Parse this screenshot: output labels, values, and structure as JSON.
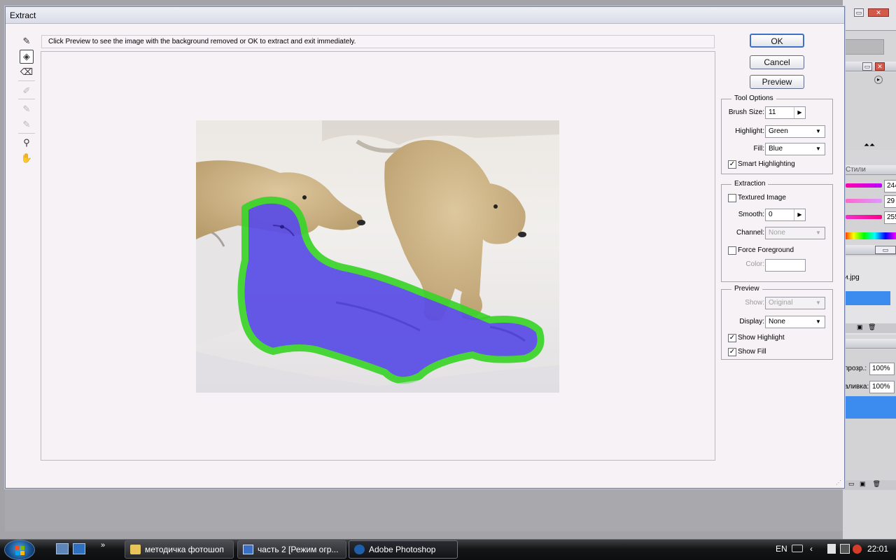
{
  "window": {
    "title": "Extract",
    "hint": "Click Preview to see the image with the background removed or OK to extract and exit immediately."
  },
  "tools": [
    {
      "name": "edge-highlighter-tool",
      "icon": "✎"
    },
    {
      "name": "fill-tool",
      "icon": "◈"
    },
    {
      "name": "eraser-tool",
      "icon": "⌫"
    },
    {
      "name": "eyedropper-tool",
      "icon": "✐"
    },
    {
      "name": "cleanup-tool",
      "icon": "✎"
    },
    {
      "name": "edge-touchup-tool",
      "icon": "✎"
    },
    {
      "name": "zoom-tool",
      "icon": "⚲"
    },
    {
      "name": "hand-tool",
      "icon": "✋"
    }
  ],
  "buttons": {
    "ok": "OK",
    "cancel": "Cancel",
    "preview": "Preview"
  },
  "tool_options": {
    "title": "Tool Options",
    "brush_size_label": "Brush Size:",
    "brush_size": "11",
    "highlight_label": "Highlight:",
    "highlight": "Green",
    "fill_label": "Fill:",
    "fill": "Blue",
    "smart_highlighting": "Smart Highlighting",
    "smart_highlighting_checked": true
  },
  "extraction": {
    "title": "Extraction",
    "textured_image": "Textured Image",
    "textured_image_checked": false,
    "smooth_label": "Smooth:",
    "smooth": "0",
    "channel_label": "Channel:",
    "channel": "None",
    "force_foreground": "Force Foreground",
    "force_foreground_checked": false,
    "color_label": "Color:"
  },
  "preview": {
    "title": "Preview",
    "show_label": "Show:",
    "show": "Original",
    "display_label": "Display:",
    "display": "None",
    "show_highlight": "Show Highlight",
    "show_highlight_checked": true,
    "show_fill": "Show Fill",
    "show_fill_checked": true
  },
  "right_panels": {
    "styles_tab": "Стили",
    "values": [
      "244",
      "29",
      "255"
    ],
    "file_name": "и.jpg",
    "opacity_label": "прозр.:",
    "opacity": "100%",
    "fill_label": "аливка:",
    "fill": "100%"
  },
  "taskbar": {
    "items": [
      {
        "label": "методичка фотошоп",
        "icon": "folder-icon"
      },
      {
        "label": "часть 2 [Режим огр...",
        "icon": "word-document-icon"
      },
      {
        "label": "Adobe Photoshop",
        "icon": "photoshop-icon"
      }
    ],
    "language": "EN",
    "clock": "22:01"
  },
  "colors": {
    "highlight": "#3bd42b",
    "fill": "#5a4de6",
    "accent": "#3d71c7"
  }
}
